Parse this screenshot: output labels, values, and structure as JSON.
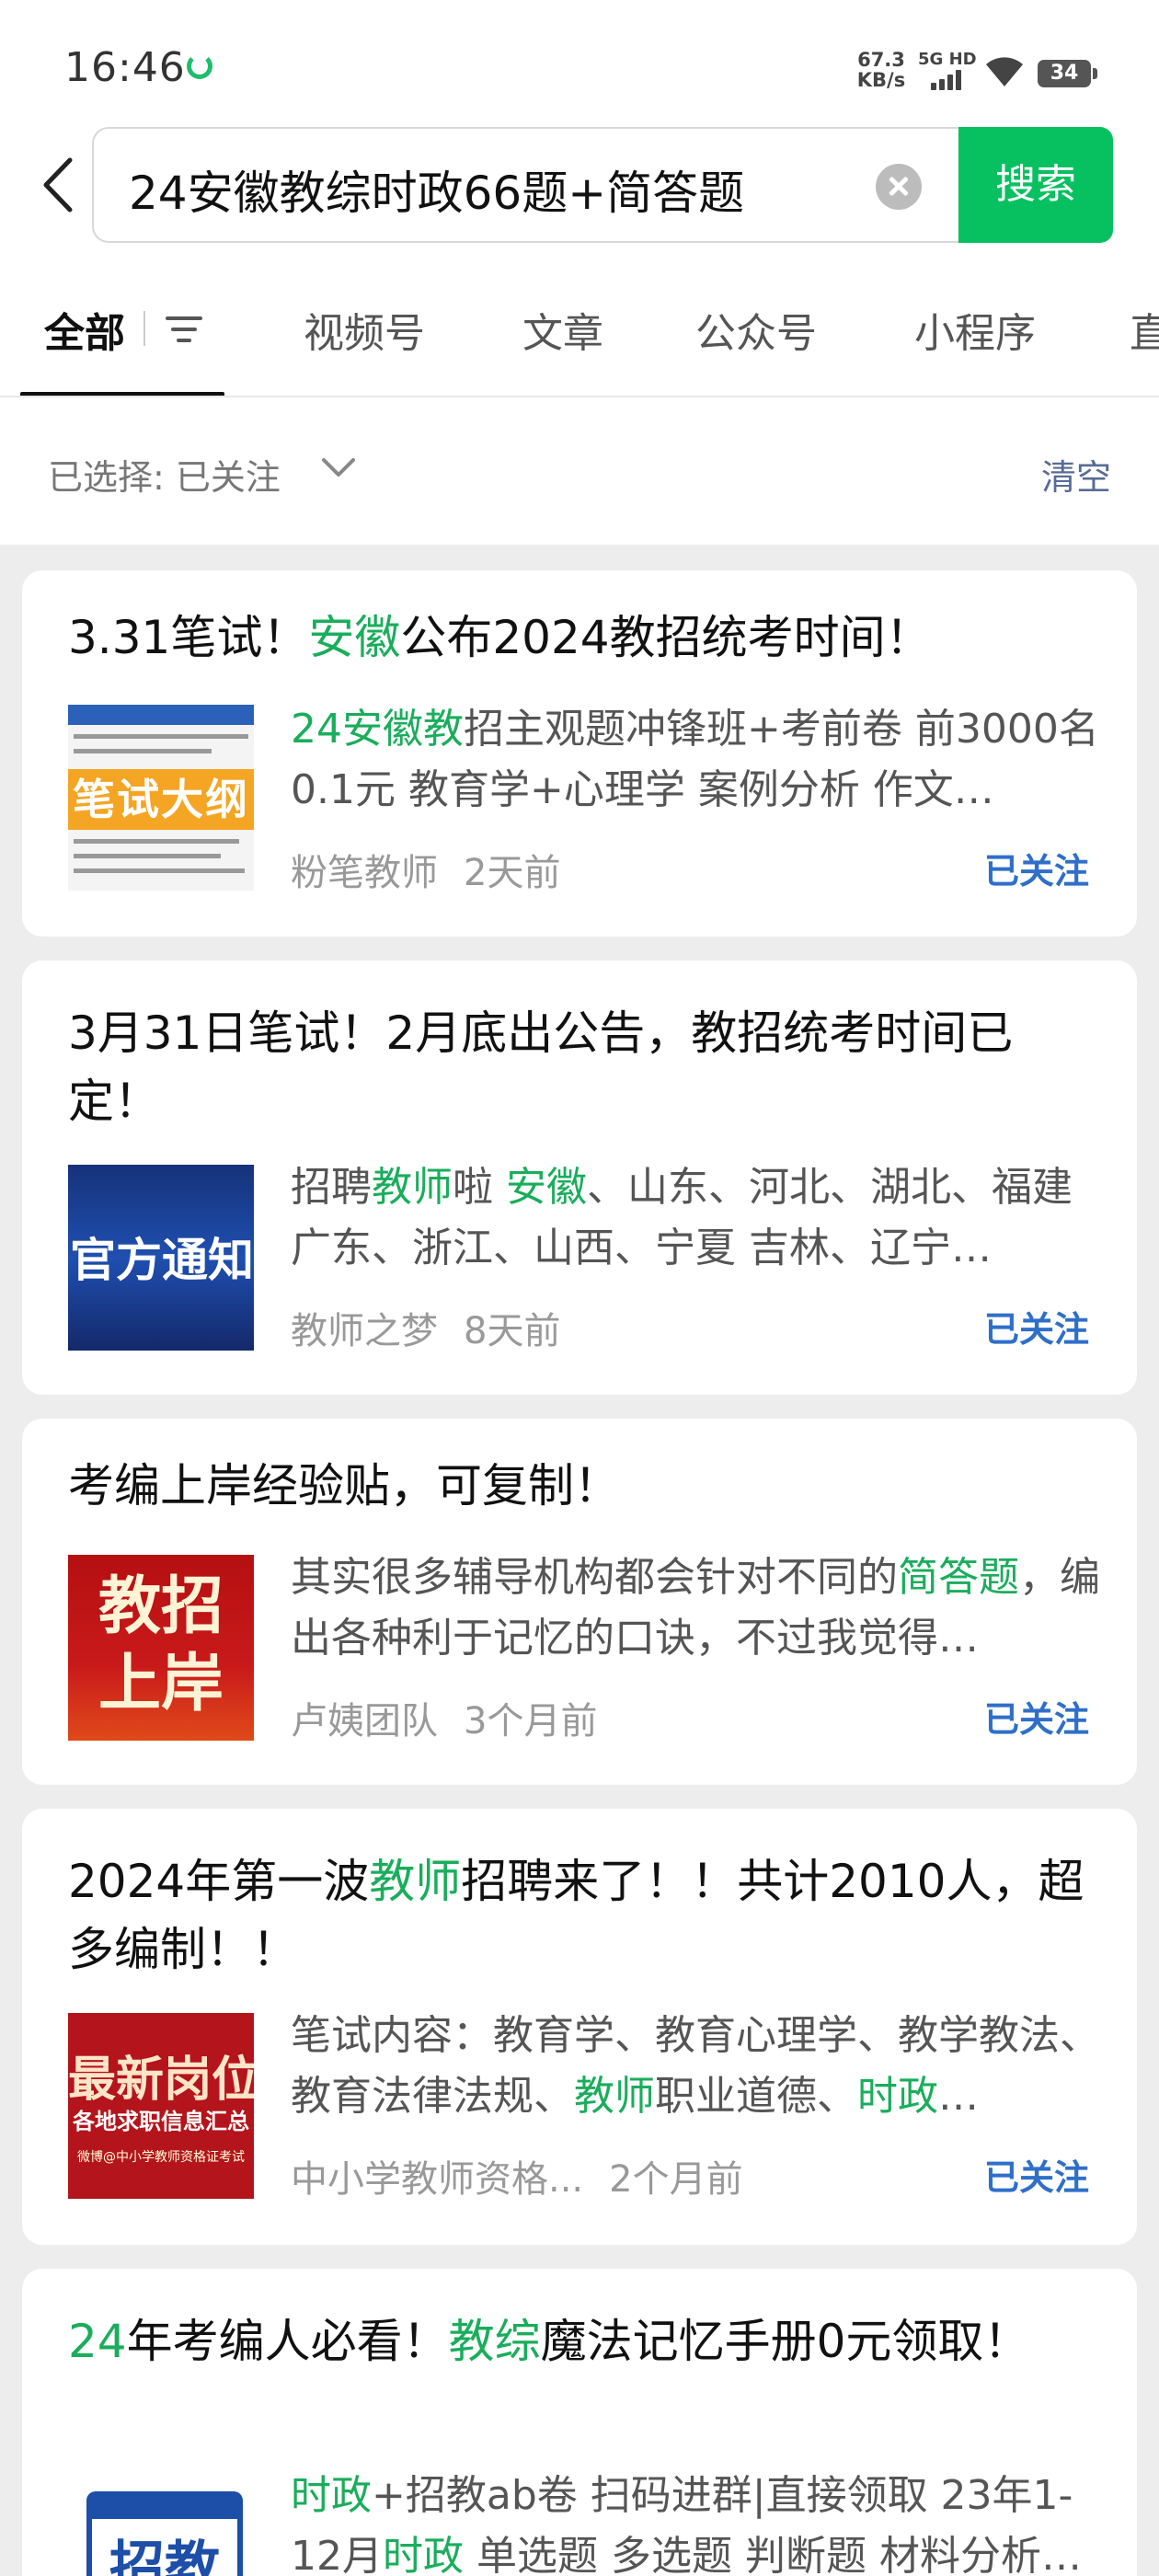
{
  "status_bar": {
    "time": "16:46",
    "net_speed_value": "67.3",
    "net_speed_unit": "KB/s",
    "network": "5G HD",
    "battery": "34"
  },
  "search": {
    "query": "24安徽教综时政66题+简答题",
    "button_label": "搜索"
  },
  "tabs": [
    "全部",
    "视频号",
    "文章",
    "公众号",
    "小程序",
    "直"
  ],
  "active_tab": "全部",
  "filter": {
    "selected_label": "已选择:",
    "selected_value": "已关注",
    "clear_label": "清空"
  },
  "colors": {
    "accent_green": "#07c160",
    "highlight_green": "#1aad5b",
    "link_blue": "#2f6fc8"
  },
  "results": [
    {
      "title": [
        "3.31笔试！",
        {
          "hl": "安徽"
        },
        "公布2024教招统考时间！"
      ],
      "thumb_text": "笔试大纲",
      "desc": [
        {
          "hl": "24安徽教"
        },
        "招主观题冲锋班+考前卷 前3000名0.1元 教育学+心理学 案例分析 作文…"
      ],
      "account": "粉笔教师",
      "time": "2天前",
      "follow": "已关注"
    },
    {
      "title": [
        "3月31日笔试！2月底出公告，教招统考时间已定！"
      ],
      "thumb_text": "官方通知",
      "desc": [
        "招聘",
        {
          "hl": "教师"
        },
        "啦 ",
        {
          "hl": "安徽"
        },
        "、山东、河北、湖北、福建 广东、浙江、山西、宁夏 吉林、辽宁…"
      ],
      "account": "教师之梦",
      "time": "8天前",
      "follow": "已关注"
    },
    {
      "title": [
        "考编上岸经验贴，可复制！"
      ],
      "thumb_text_line1": "教招",
      "thumb_text_line2": "上岸",
      "desc": [
        "其实很多辅导机构都会针对不同的",
        {
          "hl": "简答题"
        },
        "，编出各种利于记忆的口诀，不过我觉得…"
      ],
      "account": "卢姨团队",
      "time": "3个月前",
      "follow": "已关注"
    },
    {
      "title": [
        "2024年第一波",
        {
          "hl": "教师"
        },
        "招聘来了！！共计2010人，超多编制！！"
      ],
      "thumb_text": "最新岗位",
      "thumb_sub": "各地求职信息汇总",
      "thumb_small": "微博@中小学教师资格证考试",
      "desc": [
        "笔试内容：教育学、教育心理学、教学教法、教育法律法规、",
        {
          "hl": "教师"
        },
        "职业道德、",
        {
          "hl": "时政"
        },
        "…"
      ],
      "account": "中小学教师资格...",
      "time": "2个月前",
      "follow": "已关注"
    },
    {
      "title": [
        {
          "hl": "24"
        },
        "年考编人必看！",
        {
          "hl": "教综"
        },
        "魔法记忆手册0元领取！"
      ],
      "thumb_text": "招教",
      "desc": [
        {
          "hl": "时政"
        },
        "+招教ab卷 扫码进群|直接领取 23年1-12月",
        {
          "hl": "时政"
        },
        " 单选题 多选题 判断题 材料分析…"
      ]
    }
  ]
}
